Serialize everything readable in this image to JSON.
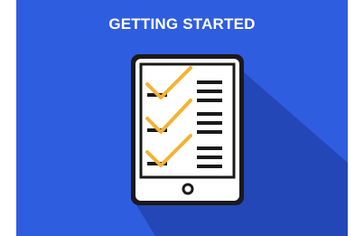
{
  "banner": {
    "title": "GETTING STARTED",
    "background_color": "#2f5de0",
    "shadow_color": "#2347b6"
  },
  "illustration": {
    "type": "tablet-checklist-icon",
    "checked_items": 3,
    "total_items": 3,
    "check_color": "#f4b233",
    "outline_color": "#1a1a1a"
  }
}
